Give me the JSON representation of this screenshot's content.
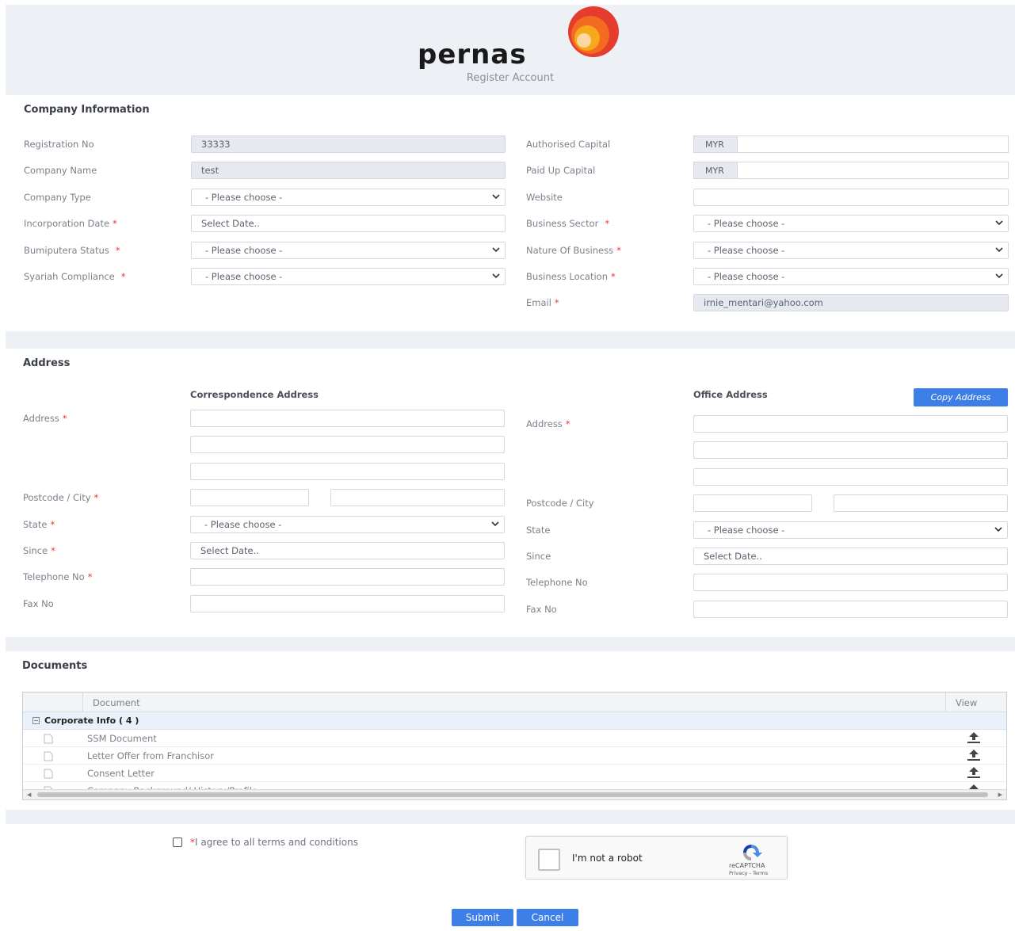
{
  "header": {
    "brand": "pernas",
    "subtitle": "Register Account"
  },
  "company": {
    "title": "Company Information",
    "registration_no": {
      "label": "Registration No",
      "value": "33333"
    },
    "company_name": {
      "label": "Company Name",
      "value": "test"
    },
    "company_type": {
      "label": "Company Type",
      "value": "- Please choose -"
    },
    "incorporation_date": {
      "label": "Incorporation Date",
      "placeholder": "Select Date.."
    },
    "bumiputera_status": {
      "label": "Bumiputera Status",
      "value": "- Please choose -"
    },
    "syariah_compliance": {
      "label": "Syariah Compliance",
      "value": "- Please choose -"
    },
    "authorised_capital": {
      "label": "Authorised Capital",
      "currency": "MYR",
      "value": ""
    },
    "paid_up_capital": {
      "label": "Paid Up Capital",
      "currency": "MYR",
      "value": ""
    },
    "website": {
      "label": "Website",
      "value": ""
    },
    "business_sector": {
      "label": "Business Sector",
      "value": "- Please choose -"
    },
    "nature_of_business": {
      "label": "Nature Of Business",
      "value": "- Please choose -"
    },
    "business_location": {
      "label": "Business Location",
      "value": "- Please choose -"
    },
    "email": {
      "label": "Email",
      "value": "irnie_mentari@yahoo.com"
    }
  },
  "address": {
    "title": "Address",
    "correspondence": {
      "heading": "Correspondence Address",
      "address_label": "Address",
      "postcode_city_label": "Postcode / City",
      "state_label": "State",
      "state_value": "- Please choose -",
      "since_label": "Since",
      "since_placeholder": "Select Date..",
      "telephone_label": "Telephone No",
      "fax_label": "Fax No"
    },
    "office": {
      "heading": "Office Address",
      "copy_button": "Copy Address",
      "address_label": "Address",
      "postcode_city_label": "Postcode / City",
      "state_label": "State",
      "state_value": "- Please choose -",
      "since_label": "Since",
      "since_placeholder": "Select Date..",
      "telephone_label": "Telephone No",
      "fax_label": "Fax No"
    }
  },
  "documents": {
    "title": "Documents",
    "columns": [
      "Document",
      "View"
    ],
    "group": "Corporate Info ( 4 )",
    "group_toggle": "−",
    "rows": [
      "SSM Document",
      "Letter Offer from Franchisor",
      "Consent Letter",
      "Company Background/ History/Profile"
    ]
  },
  "footer": {
    "required_mark": "*",
    "agree_text": "I agree to all terms and conditions",
    "captcha_text": "I'm not a robot",
    "captcha_brand": "reCAPTCHA",
    "captcha_links": "Privacy - Terms",
    "submit": "Submit",
    "cancel": "Cancel"
  },
  "required_mark": "*",
  "colors": {
    "accent": "#3d7fe6",
    "required": "#e53935",
    "band": "#edf0f4"
  }
}
